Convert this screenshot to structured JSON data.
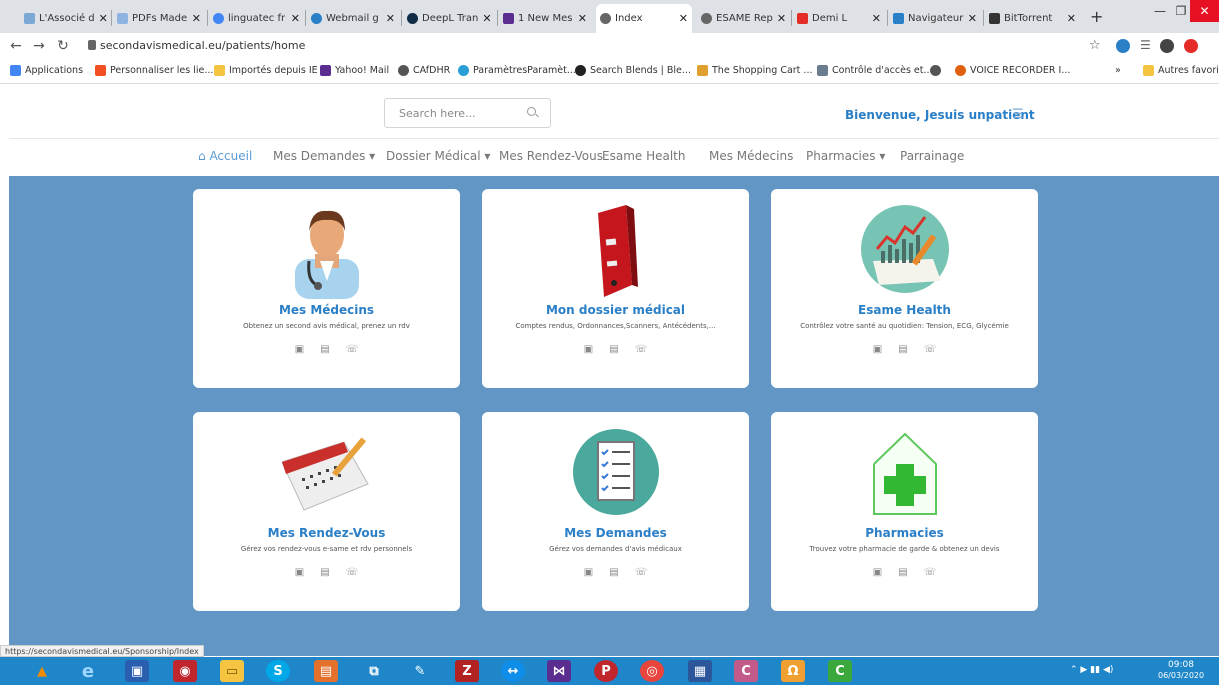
{
  "browser": {
    "tabs": [
      {
        "label": "L'Associé d",
        "color": "#7aa9d6"
      },
      {
        "label": "PDFs Made",
        "color": "#8fb3e0"
      },
      {
        "label": "linguatec fr",
        "color": "#4285f4"
      },
      {
        "label": "Webmail g",
        "color": "#2a7fc7"
      },
      {
        "label": "DeepL Tran",
        "color": "#0f2b46"
      },
      {
        "label": "1 New Mes",
        "color": "#5b2d91"
      },
      {
        "label": "Index",
        "color": "#666666"
      },
      {
        "label": "ESAME Rep",
        "color": "#666666"
      },
      {
        "label": "Demi L",
        "color": "#e52d27"
      },
      {
        "label": "Navigateur",
        "color": "#2a7fc7"
      },
      {
        "label": "BitTorrent",
        "color": "#333333"
      }
    ],
    "new_tab": "+",
    "url": "secondavismedical.eu/patients/home",
    "bookmarks": [
      "Applications",
      "Personnaliser les lie...",
      "Importés depuis IE",
      "Yahoo! Mail",
      "CAfDHR",
      "ParamètresParamèt...",
      "Search Blends | Ble...",
      "The Shopping Cart ...",
      "Contrôle d'accès et...",
      "",
      "VOICE RECORDER I..."
    ],
    "more_bookmarks": "»",
    "other_bookmarks": "Autres favoris"
  },
  "header": {
    "search_placeholder": "Search here...",
    "welcome": "Bienvenue, Jesuis unpatient"
  },
  "nav": {
    "home": "Accueil",
    "requests": "Mes Demandes",
    "record": "Dossier Médical",
    "appointments": "Mes Rendez-Vous",
    "esame": "Esame Health",
    "doctors": "Mes Médecins",
    "pharmacies": "Pharmacies",
    "sponsorship": "Parrainage"
  },
  "cards": [
    {
      "title": "Mes Médecins",
      "desc": "Obtenez un second avis médical, prenez un rdv"
    },
    {
      "title": "Mon dossier médical",
      "desc": "Comptes rendus, Ordonnances,Scanners, Antécédents,..."
    },
    {
      "title": "Esame Health",
      "desc": "Contrôlez votre santé au quotidien: Tension, ECG, Glycémie"
    },
    {
      "title": "Mes Rendez-Vous",
      "desc": "Gérez vos rendez-vous e-same et rdv personnels"
    },
    {
      "title": "Mes Demandes",
      "desc": "Gérez vos demandes d'avis médicaux"
    },
    {
      "title": "Pharmacies",
      "desc": "Trouvez votre pharmacie de garde & obtenez un devis"
    }
  ],
  "status_url": "https://secondavismedical.eu/Sponsorship/Index",
  "taskbar": {
    "time": "09:08",
    "date": "06/03/2020"
  }
}
